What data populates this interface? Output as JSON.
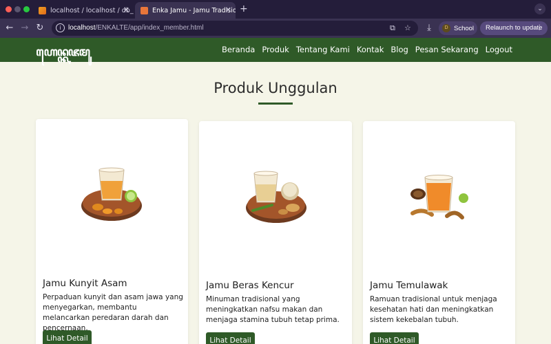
{
  "browser": {
    "tabs": [
      {
        "label": "localhost / localhost / db_uas",
        "active": false
      },
      {
        "label": "Enka Jamu - Jamu Tradisional",
        "active": true
      }
    ],
    "url_host": "localhost",
    "url_path": "/ENKALTE/app/index_member.html",
    "profile_initial": "D",
    "profile_label": "School",
    "relaunch_label": "Relaunch to update"
  },
  "site": {
    "logo_text": "ꦲꦺꦤ꧀ꦏꦗꦩꦸ",
    "nav": [
      "Beranda",
      "Produk",
      "Tentang Kami",
      "Kontak",
      "Blog",
      "Pesan Sekarang",
      "Logout"
    ],
    "section_title": "Produk Unggulan",
    "button_label": "Lihat Detail",
    "products": [
      {
        "name": "Jamu Kunyit Asam",
        "description": "Perpaduan kunyit dan asam jawa yang menyegarkan, membantu melancarkan peredaran darah dan pencernaan."
      },
      {
        "name": "Jamu Beras Kencur",
        "description": "Minuman tradisional yang meningkatkan nafsu makan dan menjaga stamina tubuh tetap prima."
      },
      {
        "name": "Jamu Temulawak",
        "description": "Ramuan tradisional untuk menjaga kesehatan hati dan meningkatkan sistem kekebalan tubuh."
      }
    ]
  },
  "colors": {
    "brand_green": "#2f5a28",
    "page_bg": "#f5f5e8",
    "browser_dark": "#241d3a"
  }
}
